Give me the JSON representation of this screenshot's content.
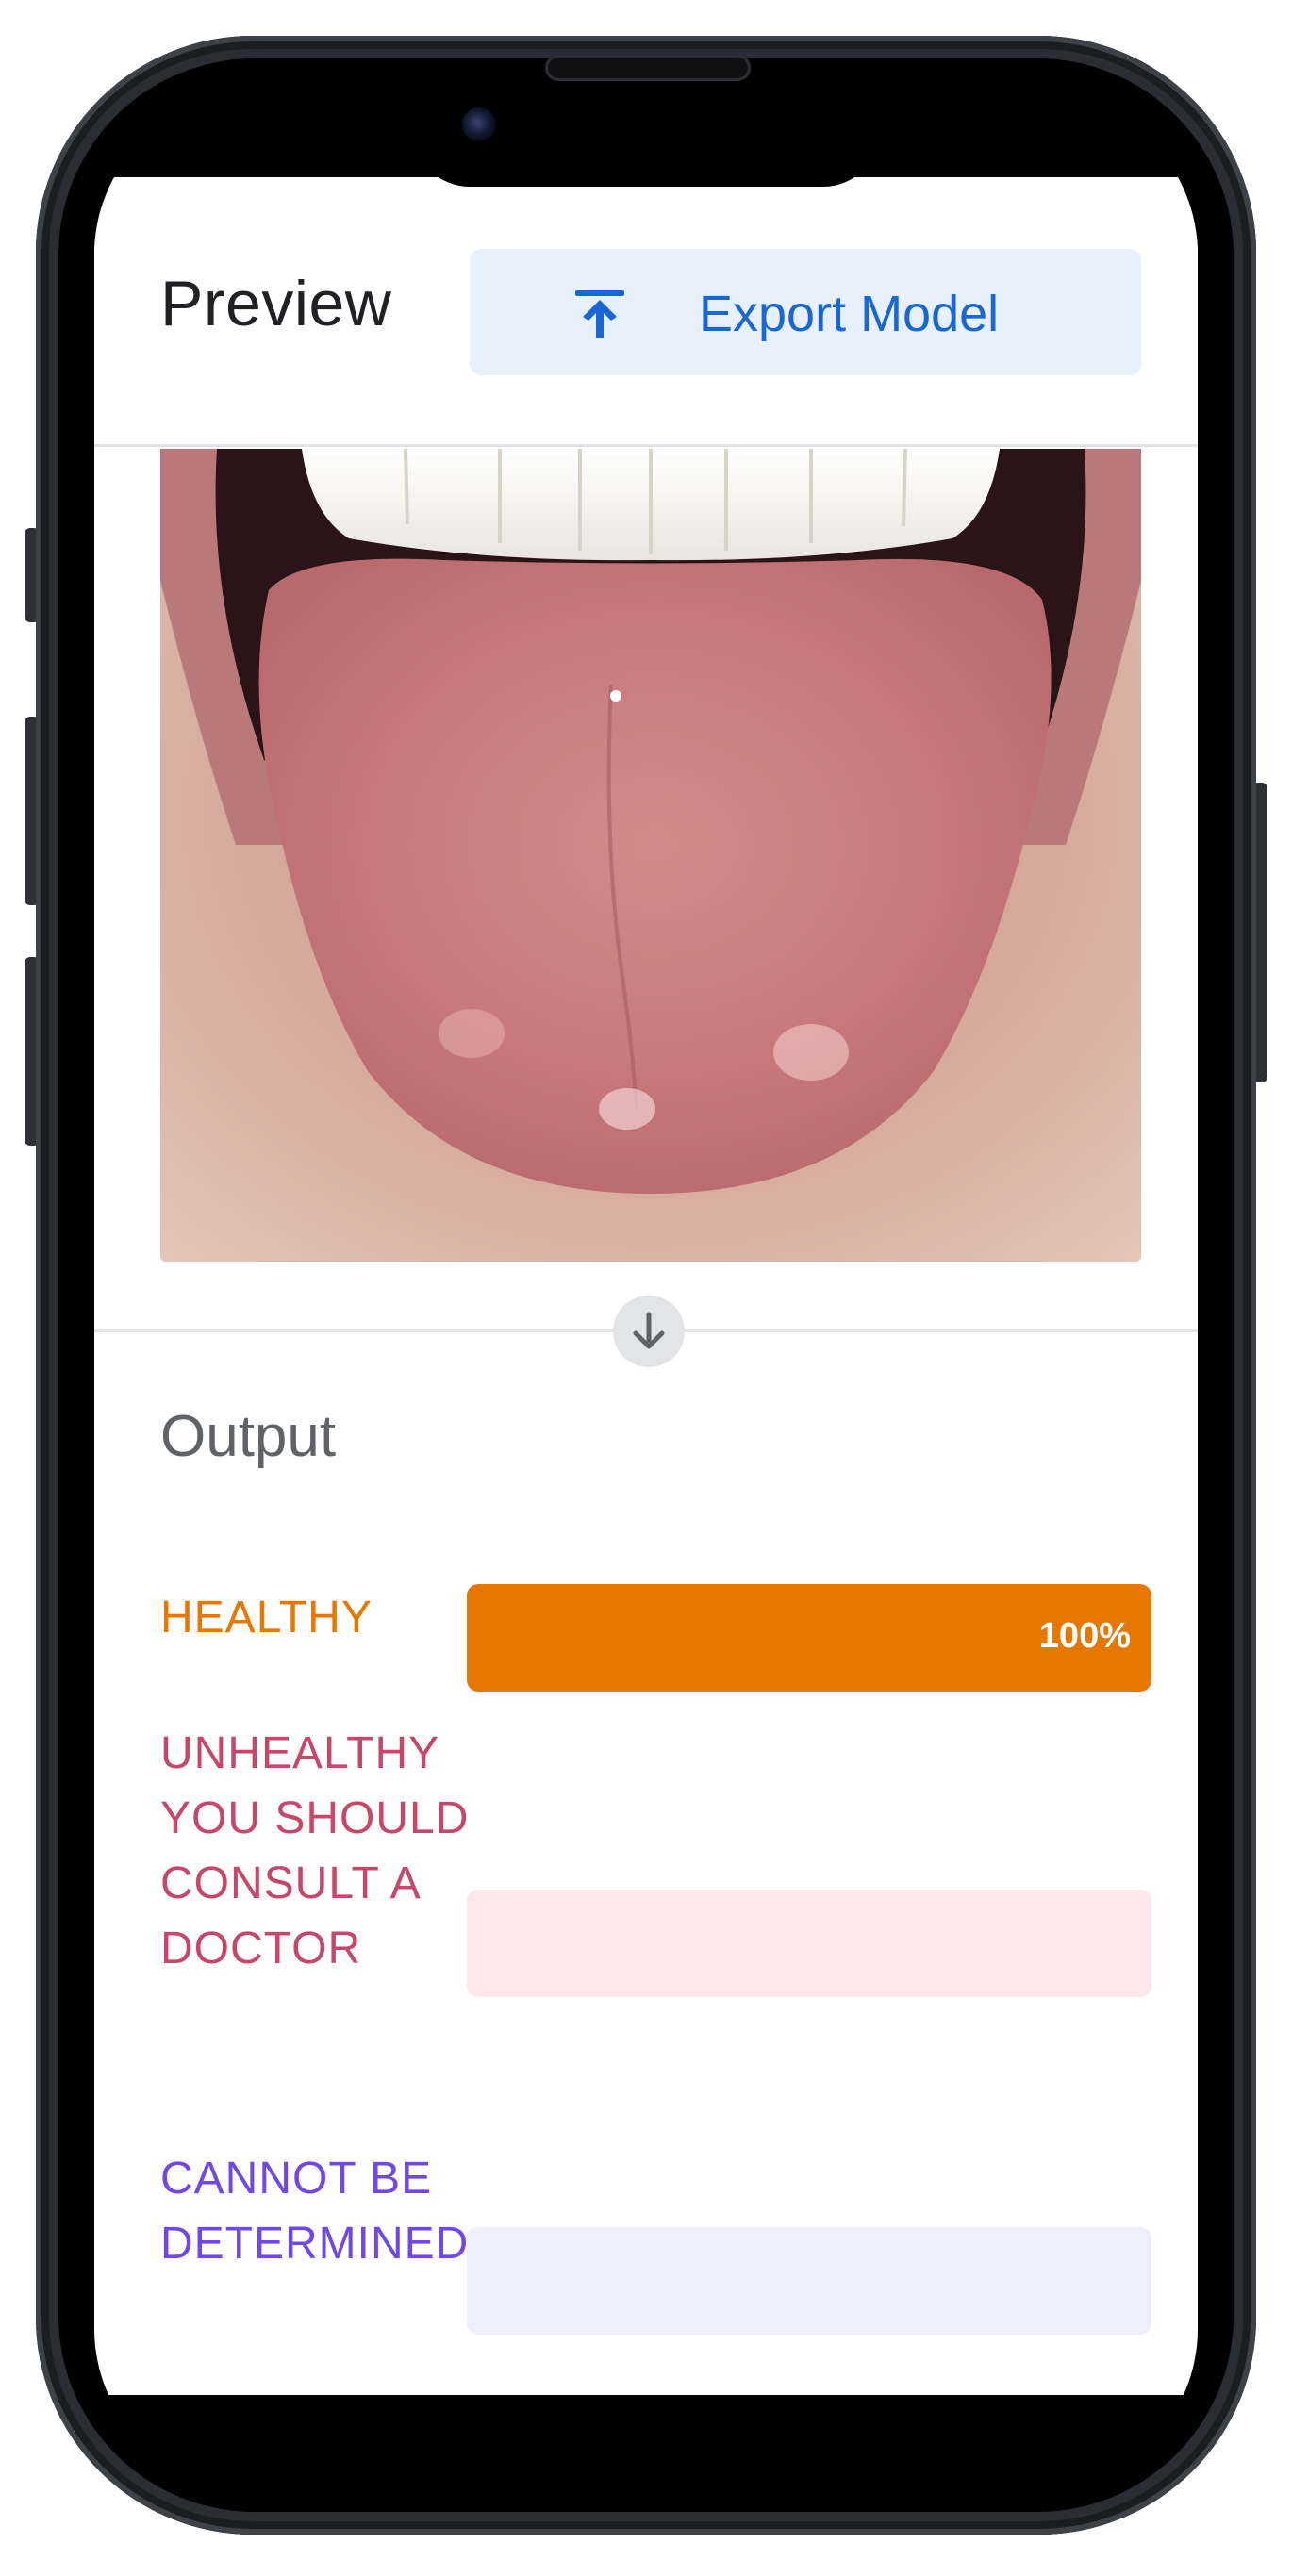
{
  "preview": {
    "title": "Preview",
    "export_label": "Export Model",
    "export_icon": "upload-arrow-icon"
  },
  "output": {
    "title": "Output",
    "classes": [
      {
        "label": "HEALTHY",
        "value": 1.0,
        "percent_text": "100%",
        "color": "#e67700",
        "track": "#fde7d3"
      },
      {
        "label": "UNHEALTHY YOU SHOULD CONSULT A DOCTOR",
        "value": 0.0,
        "percent_text": "",
        "color": "#c9466b",
        "track": "#fde8ec"
      },
      {
        "label": "CANNOT BE DETERMINED",
        "value": 0.0,
        "percent_text": "",
        "color": "#7048e8",
        "track": "#eeeefd"
      }
    ]
  },
  "icons": {
    "arrow_down": "arrow-down-icon"
  },
  "colors": {
    "accent_blue": "#1967d2",
    "button_bg": "#e8f0fc"
  }
}
